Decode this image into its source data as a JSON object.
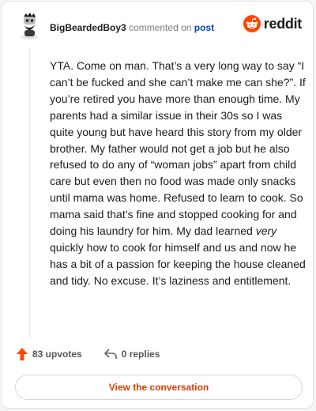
{
  "header": {
    "author": "BigBeardedBoy3",
    "action_text": "commented on",
    "post_link": "post",
    "brand": "reddit"
  },
  "comment": {
    "text_before": "YTA. Come on man. That’s a very long way to say “I can’t be fucked and she can’t make me can she?”. If you’re retired you have more than enough time. My parents had a similar issue in their 30s so I was quite young but have heard this story from my older brother. My father would not get a job but he also refused to do any of “woman jobs” apart from child care but even then no food was made only snacks until mama was home. Refused to learn to cook. So mama said that’s fine and stopped cooking for and doing his laundry for him. My dad learned ",
    "text_emphasis": "very",
    "text_after": " quickly how to cook for himself and us and now he has a bit of a passion for keeping the house cleaned and tidy. No excuse. It’s laziness and entitlement."
  },
  "footer": {
    "upvotes": "83 upvotes",
    "replies": "0 replies"
  },
  "cta": {
    "label": "View the conversation"
  },
  "colors": {
    "accent": "#ff4500",
    "link": "#0045ac",
    "cta_text": "#d93a00"
  }
}
